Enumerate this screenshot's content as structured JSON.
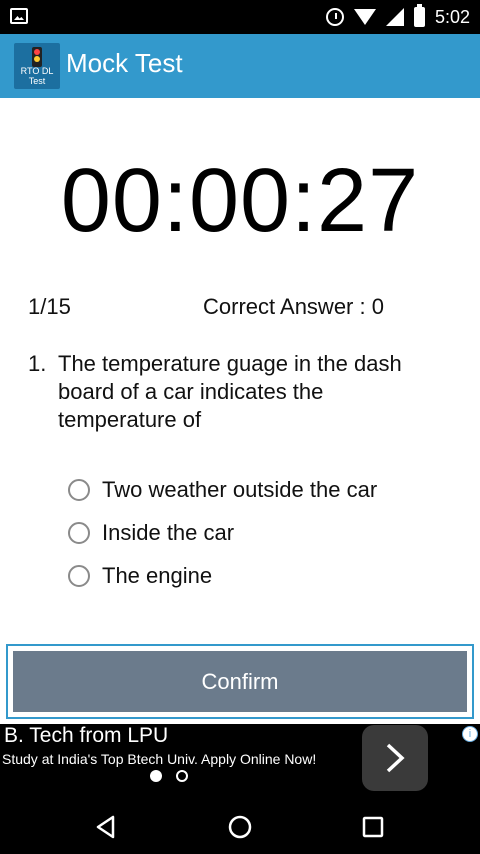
{
  "status_bar": {
    "time": "5:02"
  },
  "app_bar": {
    "title": "Mock Test",
    "logo_text": "RTO DL Test"
  },
  "quiz": {
    "timer": "00:00:27",
    "progress": "1/15",
    "correct_answer": "Correct Answer : 0",
    "question_number": "1.",
    "question_text": "The temperature guage in the dash board of a car indicates the temperature of",
    "options": [
      "Two weather outside the car",
      "Inside the car",
      "The engine"
    ],
    "confirm_label": "Confirm"
  },
  "ad": {
    "headline": "B. Tech from LPU",
    "subtext": "Study at India's Top Btech Univ. Apply Online Now!"
  },
  "colors": {
    "accent": "#3399cc",
    "confirm_bg": "#6b7b8c"
  }
}
